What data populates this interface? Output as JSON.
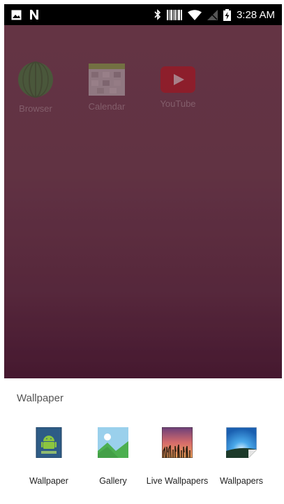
{
  "status_bar": {
    "time": "3:28 AM",
    "left_icons": [
      "image-icon",
      "n-notification-icon"
    ],
    "right_icons": [
      "bluetooth-icon",
      "barcode-icon",
      "wifi-icon",
      "no-sim-icon",
      "battery-charging-icon"
    ]
  },
  "home_screen": {
    "apps": [
      {
        "label": "Browser",
        "icon": "browser-globe-icon"
      },
      {
        "label": "Calendar",
        "icon": "calendar-icon"
      },
      {
        "label": "YouTube",
        "icon": "youtube-icon"
      }
    ]
  },
  "wallpaper_sheet": {
    "title": "Wallpaper",
    "options": [
      {
        "label": "Wallpaper",
        "icon": "android-wallpaper-icon"
      },
      {
        "label": "Gallery",
        "icon": "gallery-icon"
      },
      {
        "label": "Live Wallpapers",
        "icon": "live-wallpapers-icon"
      },
      {
        "label": "Wallpapers",
        "icon": "wallpapers-icon"
      }
    ]
  },
  "colors": {
    "status_bar_bg": "#000000",
    "home_bg_top": "#6f3e4d",
    "home_bg_bottom": "#4b1d35",
    "sheet_bg": "#ffffff"
  }
}
